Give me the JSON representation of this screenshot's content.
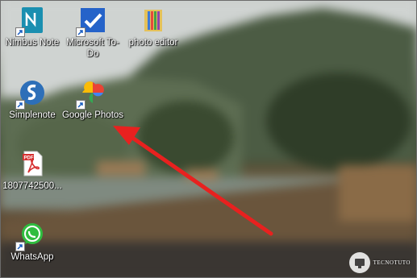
{
  "desktop": {
    "icons": [
      {
        "label": "Nimbus Note",
        "icon": "nimbus-note-icon"
      },
      {
        "label": "Microsoft To-Do",
        "icon": "microsoft-todo-icon"
      },
      {
        "label": "photo editor",
        "icon": "photo-editor-icon"
      },
      {
        "label": "Simplenote",
        "icon": "simplenote-icon"
      },
      {
        "label": "Google Photos",
        "icon": "google-photos-icon"
      },
      {
        "label": "1807742500...",
        "icon": "pdf-file-icon"
      },
      {
        "label": "WhatsApp",
        "icon": "whatsapp-icon"
      }
    ]
  },
  "annotation": {
    "arrow_color": "#e8211f",
    "points_to": "Google Photos"
  },
  "watermark": {
    "text": "TECNOTUTO"
  },
  "colors": {
    "nimbus": "#1a8fb0",
    "todo": "#2563c9",
    "pdf": "#d62f2f",
    "whatsapp": "#2fbd3f",
    "simplenote": "#2d6fb8"
  }
}
